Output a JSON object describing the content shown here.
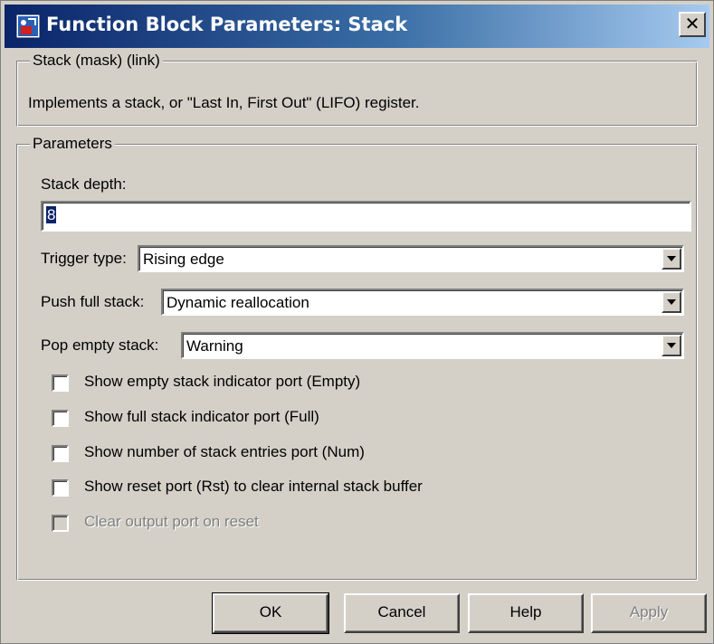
{
  "window": {
    "title": "Function Block Parameters: Stack",
    "close_glyph": "✕",
    "icon": "simulink-block-icon"
  },
  "mask_group": {
    "legend": "Stack (mask) (link)",
    "description": "Implements a stack, or \"Last In, First Out\" (LIFO) register."
  },
  "params_group": {
    "legend": "Parameters",
    "stack_depth": {
      "label": "Stack depth:",
      "value": "8"
    },
    "trigger_type": {
      "label": "Trigger type:",
      "value": "Rising edge"
    },
    "push_full": {
      "label": "Push full stack:",
      "value": "Dynamic reallocation"
    },
    "pop_empty": {
      "label": "Pop empty stack:",
      "value": "Warning"
    },
    "checkboxes": [
      {
        "label": "Show empty stack indicator port (Empty)",
        "checked": false,
        "enabled": true
      },
      {
        "label": "Show full stack indicator port (Full)",
        "checked": false,
        "enabled": true
      },
      {
        "label": "Show number of stack entries port (Num)",
        "checked": false,
        "enabled": true
      },
      {
        "label": "Show reset port (Rst) to clear internal stack buffer",
        "checked": false,
        "enabled": true
      },
      {
        "label": "Clear output port on reset",
        "checked": false,
        "enabled": false
      }
    ]
  },
  "buttons": {
    "ok": "OK",
    "cancel": "Cancel",
    "help": "Help",
    "apply": "Apply"
  },
  "colors": {
    "face": "#d4d0c8",
    "title_start": "#0a246a",
    "title_end": "#a6caf0",
    "selection": "#0a246a"
  }
}
